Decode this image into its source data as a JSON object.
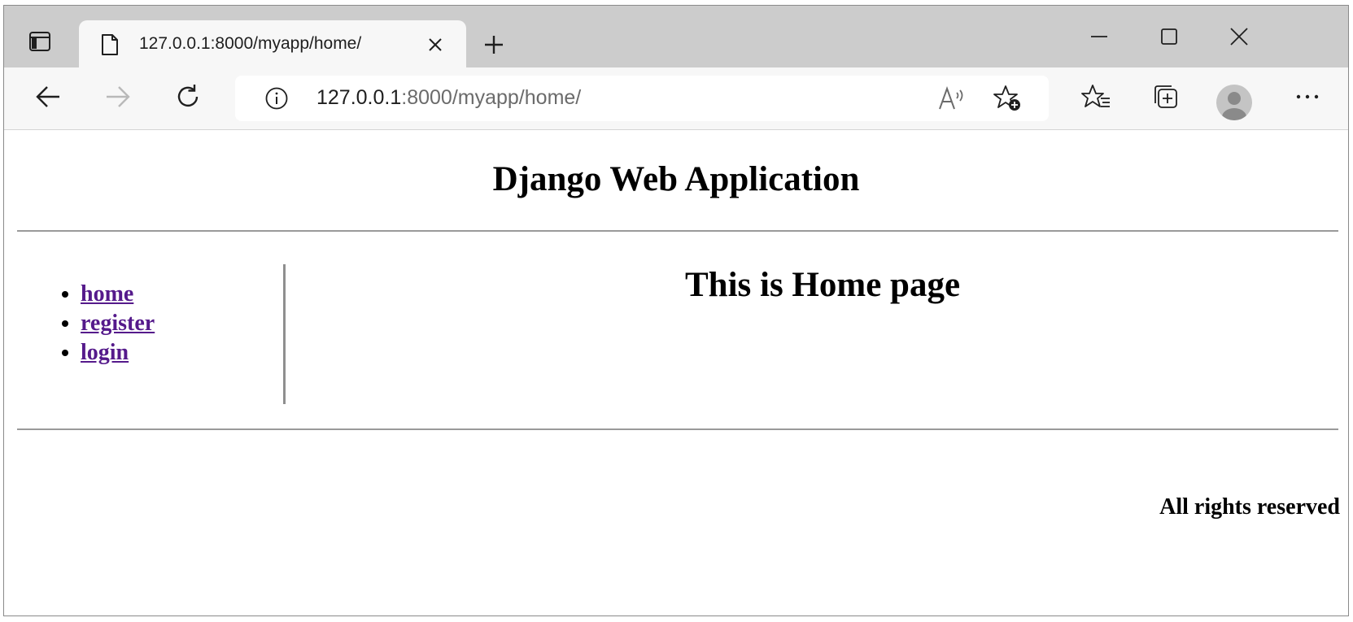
{
  "browser": {
    "tab": {
      "title": "127.0.0.1:8000/myapp/home/"
    },
    "address_bar": {
      "host": "127.0.0.1",
      "path": ":8000/myapp/home/"
    },
    "icons": {
      "tab_actions": "tab-actions-icon",
      "favicon": "page-icon",
      "close": "close-icon",
      "new_tab": "plus-icon",
      "minimize": "minimize-icon",
      "maximize": "maximize-icon",
      "window_close": "close-icon",
      "back": "back-arrow-icon",
      "forward": "forward-arrow-icon",
      "refresh": "refresh-icon",
      "info": "info-icon",
      "read_aloud": "read-aloud-icon",
      "add_favorite": "add-favorite-icon",
      "favorites": "favorites-icon",
      "collections": "collections-icon",
      "profile": "profile-avatar",
      "menu": "more-icon"
    }
  },
  "page": {
    "site_title": "Django Web Application",
    "nav": [
      {
        "label": "home"
      },
      {
        "label": "register"
      },
      {
        "label": "login"
      }
    ],
    "main_heading": "This is Home page",
    "footer": "All rights reserved"
  },
  "colors": {
    "tabstrip_bg": "#cccccc",
    "toolbar_bg": "#f7f7f7",
    "visited_link": "#551a8b"
  }
}
